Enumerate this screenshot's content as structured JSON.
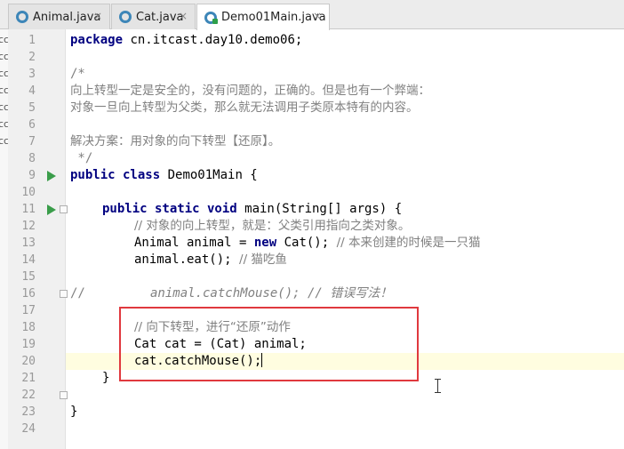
{
  "tabs": [
    {
      "label": "Animal.java",
      "close": "×",
      "active": false
    },
    {
      "label": "Cat.java",
      "close": "×",
      "active": false
    },
    {
      "label": "Demo01Main.java",
      "close": "×",
      "active": true
    }
  ],
  "project_strip": [
    "cc",
    "cc",
    "cc",
    "cc",
    "cc",
    "cc",
    "cc"
  ],
  "line_numbers": [
    "1",
    "2",
    "3",
    "4",
    "5",
    "6",
    "7",
    "8",
    "9",
    "10",
    "11",
    "12",
    "13",
    "14",
    "15",
    "16",
    "17",
    "18",
    "19",
    "20",
    "21",
    "22",
    "23",
    "24"
  ],
  "code": {
    "l1_kw": "package",
    "l1_rest": " cn.itcast.day10.demo06;",
    "l3": "/*",
    "l4": "向上转型一定是安全的，没有问题的，正确的。但是也有一个弊端：",
    "l5": "对象一旦向上转型为父类，那么就无法调用子类原本特有的内容。",
    "l7": "解决方案：用对象的向下转型【还原】。",
    "l8": " */",
    "l9_kw": "public class",
    "l9_rest": " Demo01Main {",
    "l11_kw": "public static void",
    "l11_rest": " main(String[] args) {",
    "l12": "// 对象的向上转型，就是：父类引用指向之类对象。",
    "l13_a": "Animal animal = ",
    "l13_kw": "new",
    "l13_b": " Cat(); ",
    "l13_cmt": "// 本来创建的时候是一只猫",
    "l14_a": "animal.eat(); ",
    "l14_cmt": "// 猫吃鱼",
    "l16_a": "//",
    "l16_b": "animal.catchMouse(); // 错误写法！",
    "l18": "// 向下转型，进行“还原”动作",
    "l19": "Cat cat = (Cat) animal;",
    "l20": "cat.catchMouse();",
    "l21": "}",
    "l23": "}"
  }
}
